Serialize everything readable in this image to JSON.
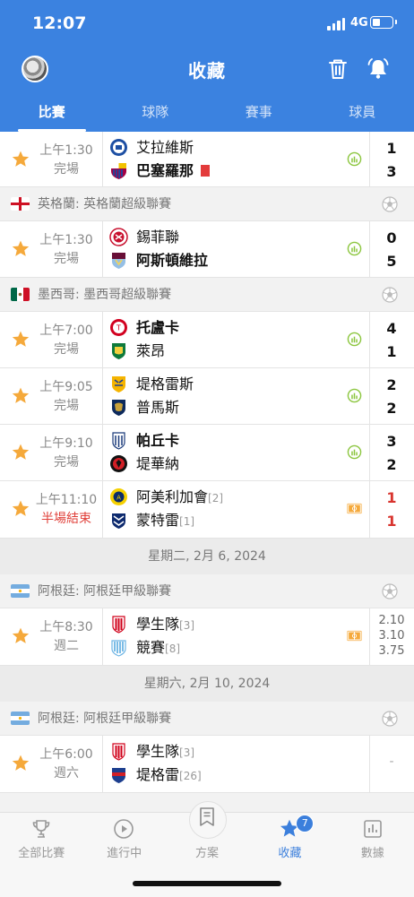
{
  "status_bar": {
    "time": "12:07",
    "network": "4G"
  },
  "header": {
    "title": "收藏"
  },
  "tabs": [
    {
      "label": "比賽",
      "active": true
    },
    {
      "label": "球隊",
      "active": false
    },
    {
      "label": "賽事",
      "active": false
    },
    {
      "label": "球員",
      "active": false
    }
  ],
  "matches": [
    {
      "time": "上午1:30",
      "status": "完場",
      "team_a": "艾拉維斯",
      "team_b": "巴塞羅那",
      "score_a": "1",
      "score_b": "3"
    },
    {
      "time": "上午1:30",
      "status": "完場",
      "team_a": "錫菲聯",
      "team_b": "阿斯頓維拉",
      "score_a": "0",
      "score_b": "5"
    },
    {
      "time": "上午7:00",
      "status": "完場",
      "team_a": "托盧卡",
      "team_b": "萊昂",
      "score_a": "4",
      "score_b": "1"
    },
    {
      "time": "上午9:05",
      "status": "完場",
      "team_a": "堤格雷斯",
      "team_b": "普馬斯",
      "score_a": "2",
      "score_b": "2"
    },
    {
      "time": "上午9:10",
      "status": "完場",
      "team_a": "帕丘卡",
      "team_b": "堤華納",
      "score_a": "3",
      "score_b": "2"
    },
    {
      "time": "上午11:10",
      "status": "半場結束",
      "team_a": "阿美利加會",
      "rank_a": "[2]",
      "team_b": "蒙特雷",
      "rank_b": "[1]",
      "score_a": "1",
      "score_b": "1"
    },
    {
      "time": "上午8:30",
      "status": "週二",
      "team_a": "學生隊",
      "rank_a": "[3]",
      "team_b": "競賽",
      "rank_b": "[8]",
      "odds": [
        "2.10",
        "3.10",
        "3.75"
      ]
    },
    {
      "time": "上午6:00",
      "status": "週六",
      "team_a": "學生隊",
      "rank_a": "[3]",
      "team_b": "堤格雷",
      "rank_b": "[26]",
      "placeholder": "-"
    }
  ],
  "leagues": [
    {
      "name": "英格蘭: 英格蘭超級聯賽"
    },
    {
      "name": "墨西哥: 墨西哥超級聯賽"
    },
    {
      "name": "阿根廷: 阿根廷甲級聯賽"
    },
    {
      "name": "阿根廷: 阿根廷甲級聯賽"
    }
  ],
  "dates": [
    {
      "label": "星期二, 2月 6, 2024"
    },
    {
      "label": "星期六, 2月 10, 2024"
    }
  ],
  "bottom_nav": [
    {
      "label": "全部比賽",
      "icon": "trophy-icon"
    },
    {
      "label": "進行中",
      "icon": "play-icon"
    },
    {
      "label": "方案",
      "icon": "bookmark-icon"
    },
    {
      "label": "收藏",
      "icon": "star-icon",
      "badge": "7",
      "active": true
    },
    {
      "label": "數據",
      "icon": "chart-icon"
    }
  ],
  "colors": {
    "brand": "#3b82e0",
    "star": "#f5a93b",
    "live_red": "#e0403a",
    "stat_green": "#8cc63f"
  }
}
